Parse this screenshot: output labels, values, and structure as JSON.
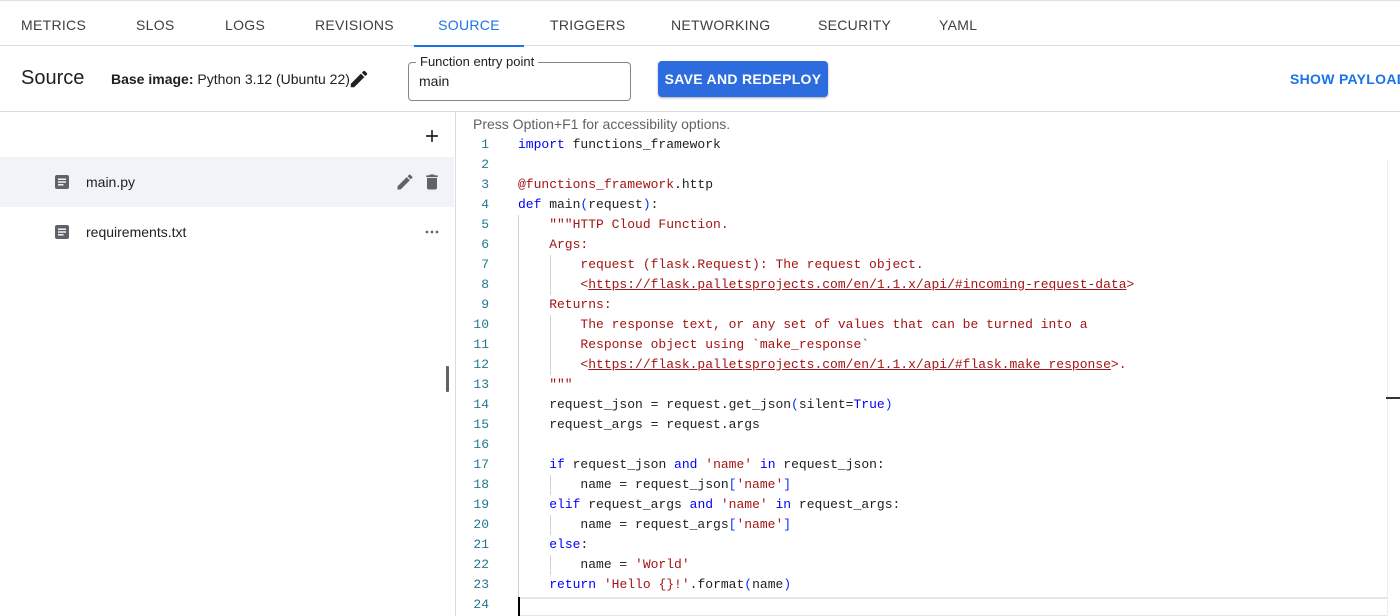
{
  "tabs": [
    {
      "label": "METRICS",
      "active": false
    },
    {
      "label": "SLOS",
      "active": false
    },
    {
      "label": "LOGS",
      "active": false
    },
    {
      "label": "REVISIONS",
      "active": false
    },
    {
      "label": "SOURCE",
      "active": true
    },
    {
      "label": "TRIGGERS",
      "active": false
    },
    {
      "label": "NETWORKING",
      "active": false
    },
    {
      "label": "SECURITY",
      "active": false
    },
    {
      "label": "YAML",
      "active": false
    }
  ],
  "toolbar": {
    "title": "Source",
    "base_image_label": "Base image:",
    "base_image_value": "Python 3.12 (Ubuntu 22)",
    "entry_point_label": "Function entry point",
    "entry_point_value": "main",
    "save_label": "SAVE AND REDEPLOY",
    "show_payload_label": "SHOW PAYLOAD"
  },
  "files": {
    "items": [
      {
        "name": "main.py",
        "selected": true
      },
      {
        "name": "requirements.txt",
        "selected": false
      }
    ]
  },
  "editor": {
    "a11y_hint": "Press Option+F1 for accessibility options.",
    "lines": [
      "1",
      "2",
      "3",
      "4",
      "5",
      "6",
      "7",
      "8",
      "9",
      "10",
      "11",
      "12",
      "13",
      "14",
      "15",
      "16",
      "17",
      "18",
      "19",
      "20",
      "21",
      "22",
      "23",
      "24"
    ]
  },
  "colors": {
    "accent": "#1a73e8",
    "primary_button": "#2d6cdf",
    "selected_row": "#f1f3f9",
    "line_number": "#237893",
    "keyword": "#0000ff",
    "string": "#a31515"
  }
}
